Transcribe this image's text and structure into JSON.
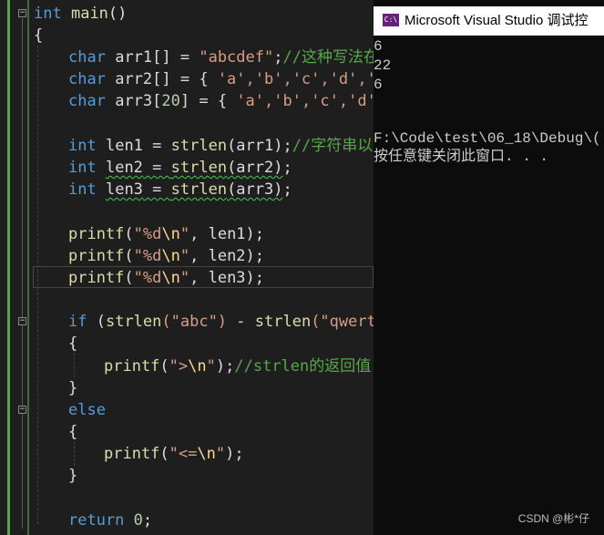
{
  "editor": {
    "colors": {
      "keyword": "#569cd6",
      "string": "#d69d85",
      "escape": "#ffd68f",
      "comment": "#57a64a",
      "function": "#dcdcaa",
      "number": "#b5cea8"
    },
    "l_main_kw": "int",
    "l_main_name": "main",
    "l_main_paren": "()",
    "l_brace_open": "{",
    "l_arr1_type": "char",
    "l_arr1_name": "arr1",
    "l_arr1_mid": "[] = ",
    "l_arr1_str": "\"abcdef\"",
    "l_arr1_semi": ";",
    "l_arr1_comment": "//这种写法在",
    "l_arr2_type": "char",
    "l_arr2_name": "arr2",
    "l_arr2_rest": "[] = { ",
    "l_arr2_chars": "'a','b','c','d','e",
    "l_arr3_type": "char",
    "l_arr3_name": "arr3",
    "l_arr3_num": "20",
    "l_arr3_mid": "] = { ",
    "l_arr3_chars": "'a','b','c','d',",
    "l_len1_type": "int",
    "l_len1_name": "len1",
    "l_len1_eq": " = ",
    "l_len1_fn": "strlen",
    "l_len1_arg": "(arr1);",
    "l_len1_comment": "//字符串以",
    "l_len2_type": "int",
    "l_len2_name": "len2",
    "l_len2_eq": " = ",
    "l_len2_fn": "strlen",
    "l_len2_arg": "(arr2)",
    "l_len2_semi": ";",
    "l_len3_type": "int",
    "l_len3_name": "len3",
    "l_len3_eq": " = ",
    "l_len3_fn": "strlen",
    "l_len3_arg": "(arr3)",
    "l_len3_semi": ";",
    "l_p1_fn": "printf",
    "l_p1_open": "(",
    "l_p1_str": "\"%d",
    "l_p1_esc": "\\n",
    "l_p1_q": "\"",
    "l_p1_rest": ", len1);",
    "l_p2_fn": "printf",
    "l_p2_open": "(",
    "l_p2_str": "\"%d",
    "l_p2_esc": "\\n",
    "l_p2_q": "\"",
    "l_p2_rest": ", len2);",
    "l_p3_fn": "printf",
    "l_p3_open": "(",
    "l_p3_str": "\"%d",
    "l_p3_esc": "\\n",
    "l_p3_q": "\"",
    "l_p3_rest": ", len3);",
    "l_if_kw": "if",
    "l_if_open": " (",
    "l_if_fn1": "strlen",
    "l_if_s1": "(\"abc\")",
    "l_if_minus": " - ",
    "l_if_fn2": "strlen",
    "l_if_s2": "(\"qwerty",
    "l_ifb_open": "{",
    "l_p4_fn": "printf",
    "l_p4_open": "(",
    "l_p4_str": "\">",
    "l_p4_esc": "\\n",
    "l_p4_q": "\"",
    "l_p4_semi": ");",
    "l_p4_comment": "//strlen的返回值",
    "l_ifb_close": "}",
    "l_else": "else",
    "l_elseb_open": "{",
    "l_p5_fn": "printf",
    "l_p5_open": "(",
    "l_p5_str": "\"<=",
    "l_p5_esc": "\\n",
    "l_p5_q": "\"",
    "l_p5_semi": ");",
    "l_elseb_close": "}",
    "l_ret_kw": "return",
    "l_ret_num": "0",
    "l_ret_semi": ";"
  },
  "console": {
    "title": "Microsoft Visual Studio 调试控",
    "icon_text": "C:\\",
    "output": [
      "6",
      "22",
      "6",
      "",
      "",
      "F:\\Code\\test\\06_18\\Debug\\(",
      "按任意键关闭此窗口. . ."
    ]
  },
  "watermark": "CSDN @彬*仔"
}
